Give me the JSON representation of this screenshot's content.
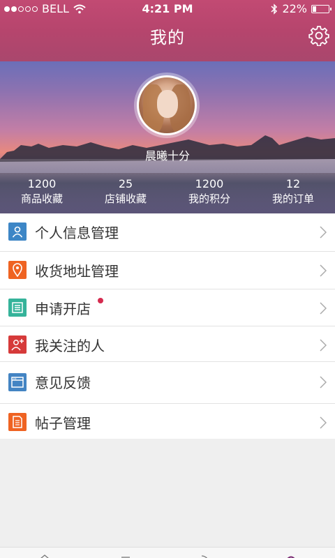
{
  "status_bar": {
    "carrier": "BELL",
    "time": "4:21 PM",
    "battery": "22%",
    "battery_level": 0.22
  },
  "header": {
    "title": "我的",
    "settings_icon": "gear-icon"
  },
  "profile": {
    "name": "晨曦十分",
    "stats": [
      {
        "value": "1200",
        "label": "商品收藏"
      },
      {
        "value": "25",
        "label": "店铺收藏"
      },
      {
        "value": "1200",
        "label": "我的积分"
      },
      {
        "value": "12",
        "label": "我的订单"
      }
    ]
  },
  "menu": {
    "items": [
      {
        "label": "个人信息管理",
        "icon": "person-icon",
        "color": "#3d86c6"
      },
      {
        "label": "收货地址管理",
        "icon": "location-pin-icon",
        "color": "#ef6322"
      },
      {
        "label": "申请开店",
        "icon": "shop-list-icon",
        "color": "#35b39a",
        "badge": true
      },
      {
        "label": "我关注的人",
        "icon": "add-person-icon",
        "color": "#d63a3a"
      },
      {
        "label": "意见反馈",
        "icon": "browser-window-icon",
        "color": "#4384c3"
      },
      {
        "label": "帖子管理",
        "icon": "document-icon",
        "color": "#ef6322"
      }
    ]
  },
  "colors": {
    "header": "#b6456d",
    "badge": "#d52b4f"
  }
}
